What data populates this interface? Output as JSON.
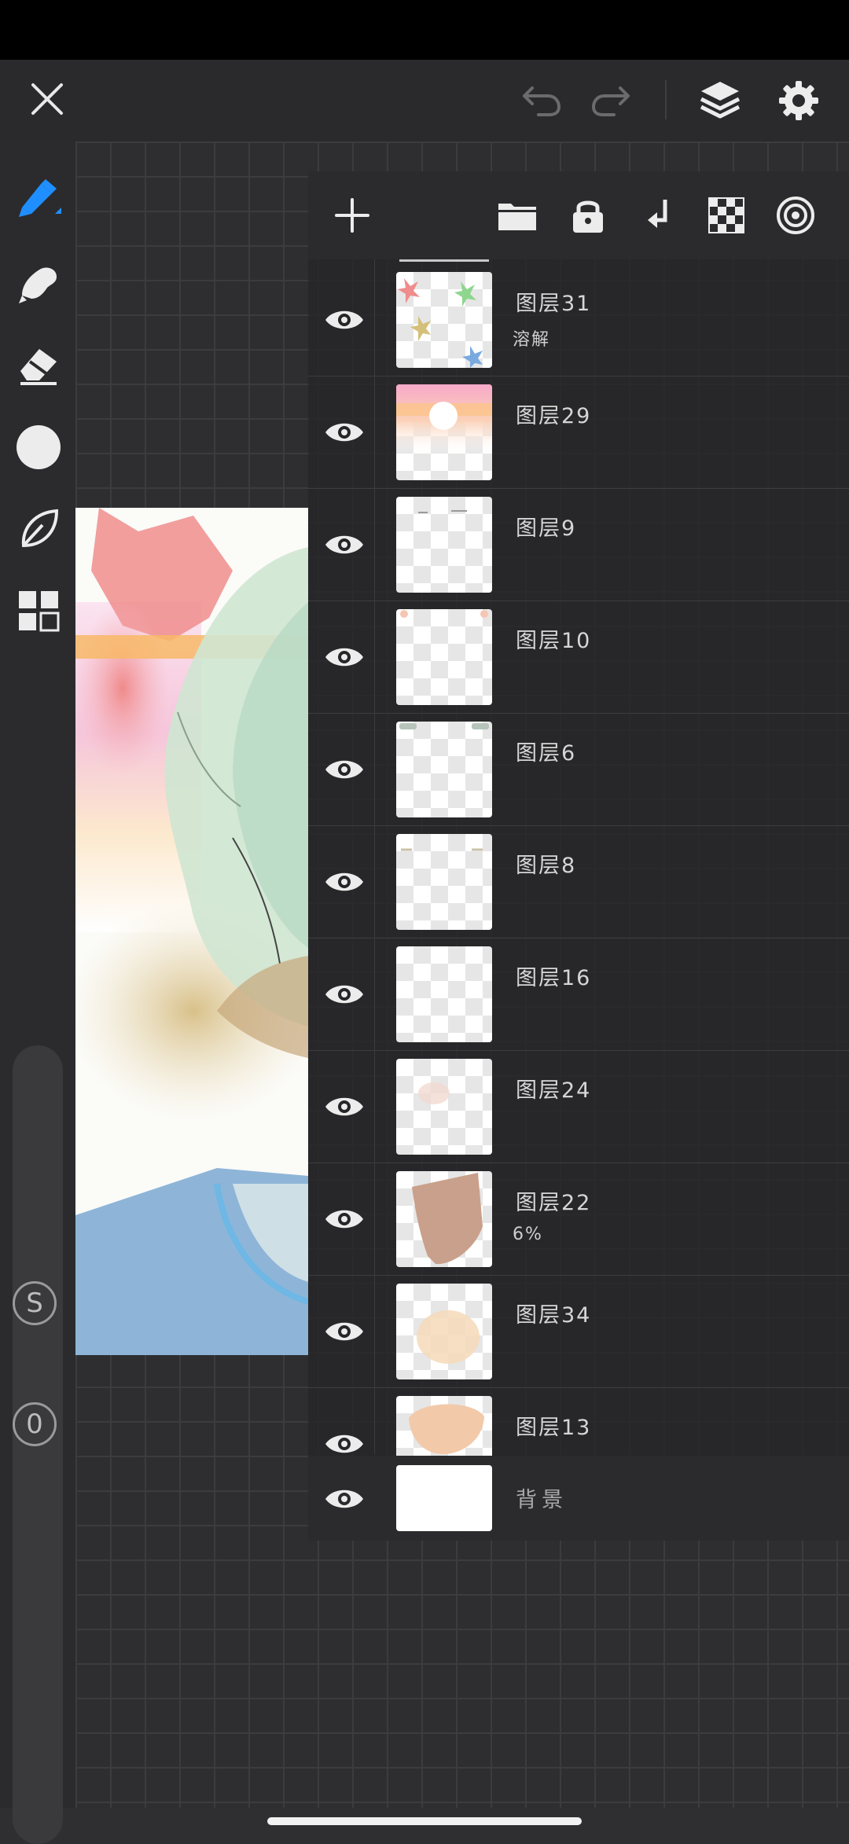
{
  "top_bar": {
    "close_icon": "close-icon",
    "undo_icon": "undo-icon",
    "redo_icon": "redo-icon",
    "layers_icon": "layers-icon",
    "settings_icon": "settings-icon"
  },
  "tools": [
    "brush-icon",
    "smudge-icon",
    "eraser-icon",
    "color-icon",
    "leaf-icon",
    "grid-icon"
  ],
  "left_toolbar": {
    "size_label": "S",
    "opacity_label": "0"
  },
  "layers_header_icons": [
    "add-icon",
    "folder-icon",
    "lock-icon",
    "merge-down-icon",
    "checker-icon",
    "target-icon"
  ],
  "layers": [
    {
      "name": "图层31",
      "sub": "溶解"
    },
    {
      "name": "图层29",
      "sub": ""
    },
    {
      "name": "图层9",
      "sub": ""
    },
    {
      "name": "图层10",
      "sub": ""
    },
    {
      "name": "图层6",
      "sub": ""
    },
    {
      "name": "图层8",
      "sub": ""
    },
    {
      "name": "图层16",
      "sub": ""
    },
    {
      "name": "图层24",
      "sub": ""
    },
    {
      "name": "图层22",
      "sub": "6%"
    },
    {
      "name": "图层34",
      "sub": ""
    },
    {
      "name": "图层13",
      "sub": ""
    }
  ],
  "background_layer": {
    "name": "背景"
  },
  "colors": {
    "accent": "#1f8fff",
    "panel": "#2b2b2d"
  }
}
